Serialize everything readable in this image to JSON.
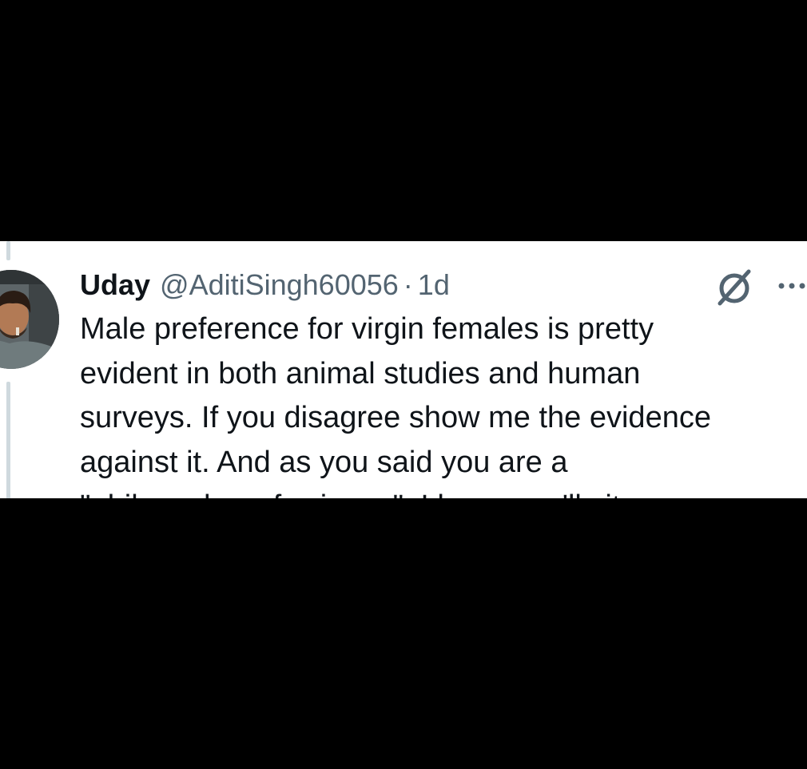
{
  "tweet": {
    "display_name": "Uday",
    "handle": "@AditiSingh60056",
    "separator": "·",
    "age": "1d",
    "text_lines": [
      "Male preference for virgin females is pretty",
      "evident in both animal studies and human",
      "surveys. If you disagree show me the evidence",
      "against it. And as you said you are a",
      "\"philosopher of science\", I hope you'll cite"
    ]
  },
  "icons": {
    "avatar": "avatar-illustration",
    "grok": "grok-icon",
    "more": "more-options-icon"
  },
  "colors": {
    "background": "#000000",
    "card": "#ffffff",
    "text_primary": "#0f1419",
    "text_secondary": "#536471",
    "thread_line": "#cfd9de"
  }
}
